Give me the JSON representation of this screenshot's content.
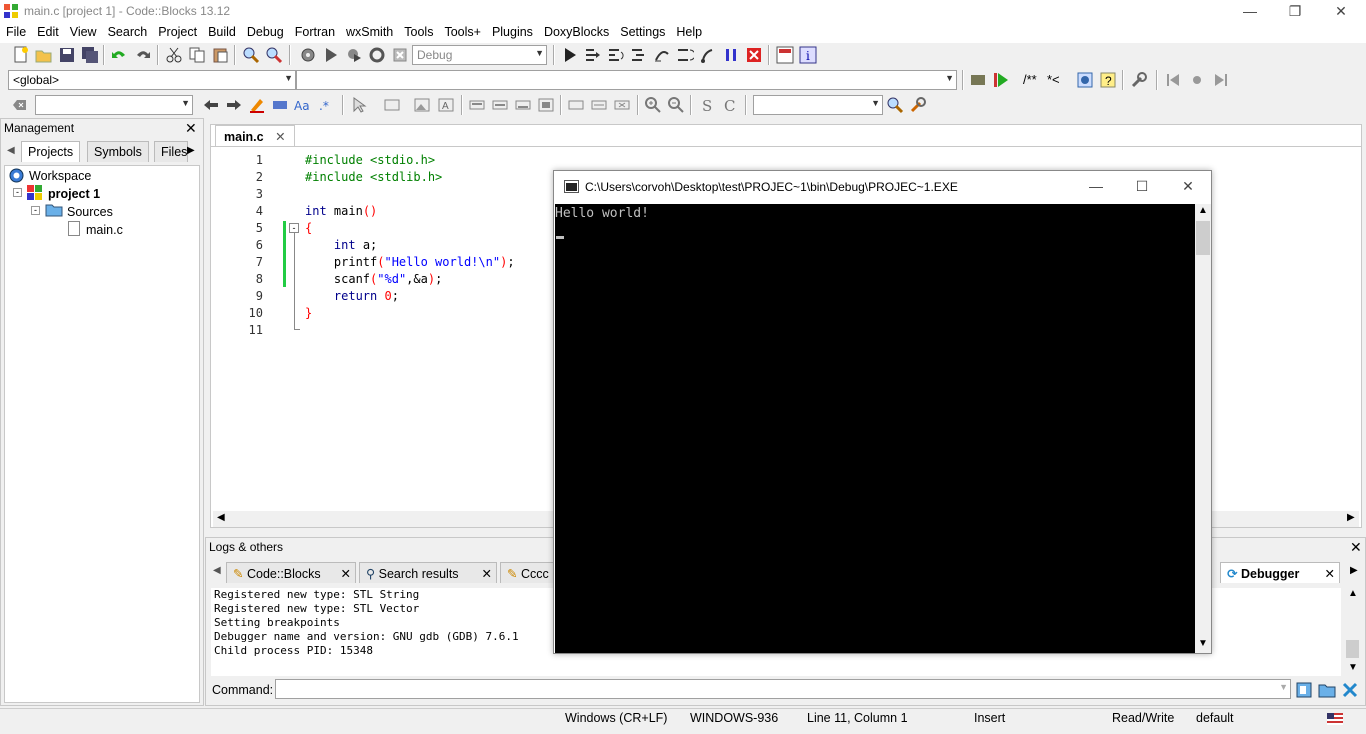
{
  "window": {
    "title": "main.c [project 1] - Code::Blocks 13.12"
  },
  "menu": [
    "File",
    "Edit",
    "View",
    "Search",
    "Project",
    "Build",
    "Debug",
    "Fortran",
    "wxSmith",
    "Tools",
    "Tools+",
    "Plugins",
    "DoxyBlocks",
    "Settings",
    "Help"
  ],
  "toolbar": {
    "build_target": "Debug",
    "scope": "<global>",
    "comment_label": "/**",
    "comment2_label": "*<"
  },
  "management": {
    "title": "Management",
    "tabs": [
      "Projects",
      "Symbols",
      "Files"
    ],
    "tree": {
      "workspace": "Workspace",
      "project": "project 1",
      "folder": "Sources",
      "file": "main.c"
    }
  },
  "editor": {
    "tab": "main.c",
    "line_numbers": [
      "1",
      "2",
      "3",
      "4",
      "5",
      "6",
      "7",
      "8",
      "9",
      "10",
      "11"
    ]
  },
  "console": {
    "title": "C:\\Users\\corvoh\\Desktop\\test\\PROJEC~1\\bin\\Debug\\PROJEC~1.EXE",
    "output": "Hello world!"
  },
  "logs": {
    "title": "Logs & others",
    "tabs": [
      "Code::Blocks",
      "Search results",
      "Cccc",
      "Debugger"
    ],
    "lines": [
      "Registered new type: STL String",
      "Registered new type: STL Vector",
      "Setting breakpoints",
      "Debugger name and version: GNU gdb (GDB) 7.6.1",
      "Child process PID: 15348"
    ],
    "command_label": "Command:"
  },
  "status": {
    "eol": "Windows (CR+LF)",
    "encoding": "WINDOWS-936",
    "position": "Line 11, Column 1",
    "mode": "Insert",
    "access": "Read/Write",
    "profile": "default"
  }
}
